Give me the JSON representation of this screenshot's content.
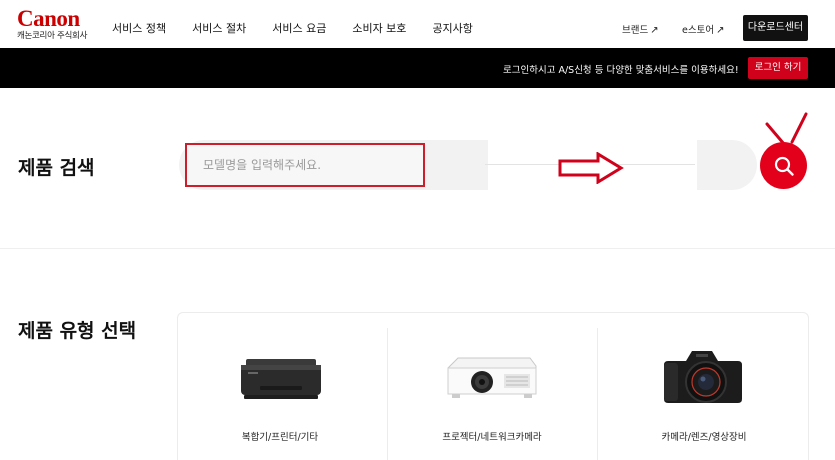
{
  "header": {
    "logo": {
      "wordmark": "Canon",
      "subtitle": "캐논코리아 주식회사"
    },
    "nav": [
      {
        "label": "서비스 정책"
      },
      {
        "label": "서비스 절차"
      },
      {
        "label": "서비스 요금"
      },
      {
        "label": "소비자 보호"
      },
      {
        "label": "공지사항"
      }
    ],
    "brand_link": "브랜드",
    "estore_link": "e스토어",
    "download_button": "다운로드센터"
  },
  "banner": {
    "message": "로그인하시고 A/S신청 등 다양한 맞춤서비스를 이용하세요!",
    "login_button": "로그인 하기"
  },
  "search": {
    "title": "제품 검색",
    "placeholder": "모델명을 입력해주세요."
  },
  "product_type": {
    "title": "제품 유형 선택",
    "items": [
      {
        "label": "복합기/프린터/기타",
        "icon": "printer-image"
      },
      {
        "label": "프로젝터/네트워크카메라",
        "icon": "projector-image"
      },
      {
        "label": "카메라/렌즈/영상장비",
        "icon": "camera-image"
      }
    ]
  },
  "colors": {
    "brand_red": "#e3001b",
    "banner_black": "#000000",
    "annotation_red": "#cc1f2b"
  }
}
